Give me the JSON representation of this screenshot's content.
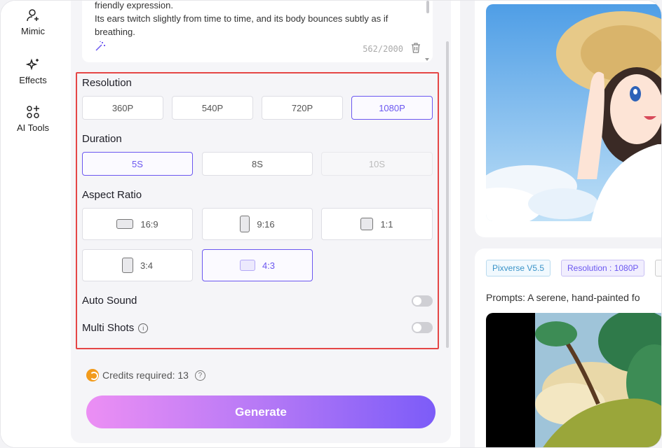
{
  "nav": {
    "items": [
      {
        "label": "Mimic",
        "icon": "person-plus-icon"
      },
      {
        "label": "Effects",
        "icon": "sparkle-icon"
      },
      {
        "label": "AI Tools",
        "icon": "grid-sparkle-icon"
      }
    ]
  },
  "prompt": {
    "lines": [
      "friendly expression.",
      "Its ears twitch slightly from time to time, and its body bounces subtly as if",
      "breathing."
    ],
    "char_count": "562/2000"
  },
  "resolution": {
    "label": "Resolution",
    "options": [
      "360P",
      "540P",
      "720P",
      "1080P"
    ],
    "selected": "1080P"
  },
  "duration": {
    "label": "Duration",
    "options": [
      "5S",
      "8S",
      "10S"
    ],
    "selected": "5S",
    "disabled": [
      "10S"
    ]
  },
  "aspect_ratio": {
    "label": "Aspect Ratio",
    "options": [
      "16:9",
      "9:16",
      "1:1",
      "3:4",
      "4:3"
    ],
    "selected": "4:3"
  },
  "auto_sound": {
    "label": "Auto Sound",
    "enabled": false
  },
  "multi_shots": {
    "label": "Multi Shots",
    "enabled": false,
    "info_glyph": "i"
  },
  "credits": {
    "text": "Credits required: 13",
    "help_glyph": "?"
  },
  "generate_label": "Generate",
  "gallery": {
    "tags": [
      "Pixverse V5.5",
      "Resolution : 1080P"
    ],
    "prompt_preview": "Prompts: A serene, hand-painted fo"
  },
  "colors": {
    "accent": "#6b57f0",
    "highlight_border": "#e54646",
    "generate_start": "#ec8ff4",
    "generate_end": "#7c5cf8"
  }
}
